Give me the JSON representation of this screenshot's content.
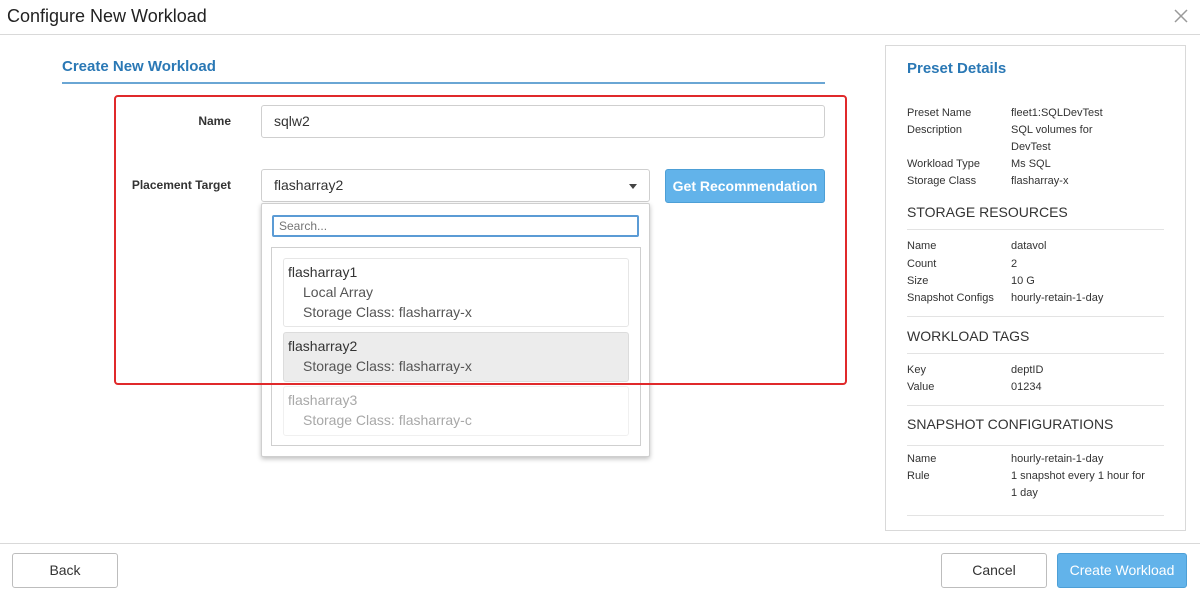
{
  "dialog": {
    "title": "Configure New Workload",
    "close_icon": "close-icon"
  },
  "form": {
    "section_title": "Create New Workload",
    "name_label": "Name",
    "name_value": "sqlw2",
    "placement_label": "Placement Target",
    "placement_value": "flasharray2",
    "recommend_button": "Get Recommendation"
  },
  "dropdown": {
    "search_placeholder": "Search...",
    "options": [
      {
        "name": "flasharray1",
        "details": [
          "Local Array",
          "Storage Class: flasharray-x"
        ],
        "state": "normal"
      },
      {
        "name": "flasharray2",
        "details": [
          "Storage Class: flasharray-x"
        ],
        "state": "selected"
      },
      {
        "name": "flasharray3",
        "details": [
          "Storage Class: flasharray-c"
        ],
        "state": "disabled"
      }
    ]
  },
  "preset": {
    "title": "Preset Details",
    "fields": [
      {
        "key": "Preset Name",
        "value": "fleet1:SQLDevTest"
      },
      {
        "key": "Description",
        "value": "SQL volumes for DevTest"
      },
      {
        "key": "Workload Type",
        "value": "Ms SQL"
      },
      {
        "key": "Storage Class",
        "value": "flasharray-x"
      }
    ],
    "storage_resources": {
      "heading": "STORAGE RESOURCES",
      "fields": [
        {
          "key": "Name",
          "value": "datavol"
        },
        {
          "key": "Count",
          "value": "2"
        },
        {
          "key": "Size",
          "value": "10 G"
        },
        {
          "key": "Snapshot Configs",
          "value": "hourly-retain-1-day"
        }
      ]
    },
    "workload_tags": {
      "heading": "WORKLOAD TAGS",
      "fields": [
        {
          "key": "Key",
          "value": "deptID"
        },
        {
          "key": "Value",
          "value": "01234"
        }
      ]
    },
    "snapshot_configurations": {
      "heading": "SNAPSHOT CONFIGURATIONS",
      "fields": [
        {
          "key": "Name",
          "value": "hourly-retain-1-day"
        },
        {
          "key": "Rule",
          "value": "1 snapshot every 1 hour for 1 day"
        }
      ]
    }
  },
  "footer": {
    "back": "Back",
    "cancel": "Cancel",
    "create": "Create Workload"
  },
  "colors": {
    "accent": "#2a78b5",
    "primary_button": "#62b3ea",
    "highlight": "#e0292b"
  }
}
